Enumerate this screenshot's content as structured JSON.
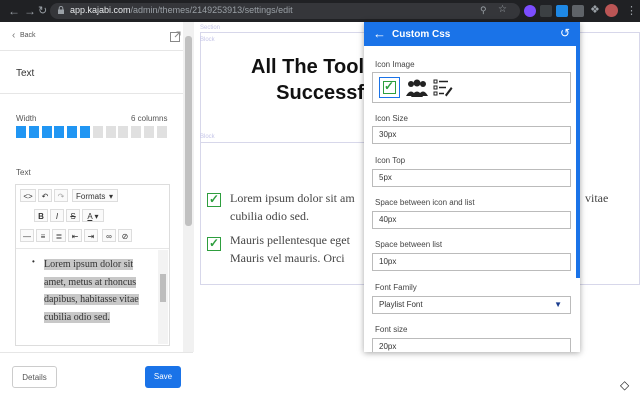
{
  "browser": {
    "url_host": "app.kajabi.com",
    "url_path": "/admin/themes/2149253913/settings/edit"
  },
  "editor": {
    "back_label": "Back",
    "section_title": "Text",
    "width_label": "Width",
    "width_value": "6 columns",
    "width_columns_filled": 6,
    "width_columns_total": 12,
    "text_label": "Text",
    "formats_label": "Formats",
    "content": "Lorem ipsum dolor sit amet, metus at rhoncus dapibus, habitasse vitae cubilia odio sed.",
    "details_label": "Details",
    "save_label": "Save"
  },
  "preview": {
    "section_tag": "Section",
    "block_tag": "Block",
    "block_tag_2": "Block",
    "heading_line1": "All The Tool",
    "heading_line2": "Successf",
    "item1_line1": "Lorem ipsum dolor sit am",
    "item1_line2": "cubilia odio sed.",
    "item1_tail": "vitae",
    "item2_line1": "Mauris pellentesque eget",
    "item2_line2": "Mauris vel mauris. Orci"
  },
  "popup": {
    "title": "Custom Css",
    "icon_image_label": "Icon Image",
    "icon_size_label": "Icon Size",
    "icon_size_value": "30px",
    "icon_top_label": "Icon Top",
    "icon_top_value": "5px",
    "space_icon_list_label": "Space between icon and list",
    "space_icon_list_value": "40px",
    "space_list_label": "Space between list",
    "space_list_value": "10px",
    "font_family_label": "Font Family",
    "font_family_value": "Playlist Font",
    "font_size_label": "Font size",
    "font_size_value": "20px"
  },
  "colors": {
    "accent": "#1a73e8",
    "check_green": "#2e9e3e",
    "width_segment": "#2196f3",
    "chrome_bg": "#202124"
  }
}
